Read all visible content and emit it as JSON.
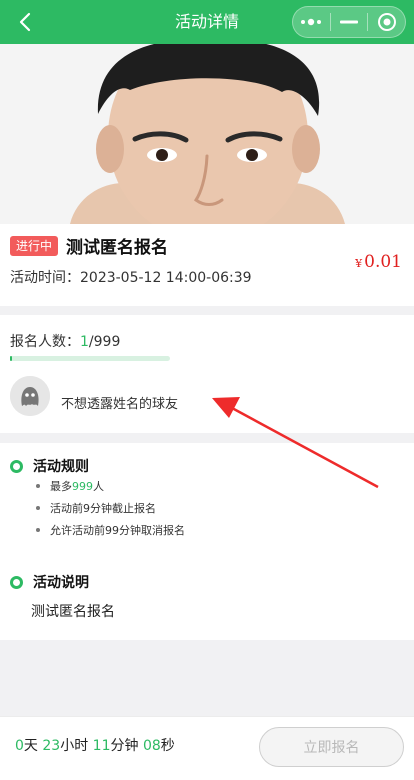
{
  "navbar": {
    "title": "活动详情",
    "icons": [
      "back-icon",
      "more-dots-icon",
      "minimize-icon",
      "close-target-icon"
    ]
  },
  "activity": {
    "status_badge": "进行中",
    "title": "测试匿名报名",
    "price_currency": "¥",
    "price_value": "0.01",
    "time_label": "活动时间：",
    "time_value": "2023-05-12 14:00-06:39"
  },
  "signup": {
    "label": "报名人数：",
    "current": "1",
    "separator": "/",
    "max": "999",
    "progress_fraction": 0.001,
    "member_name": "不想透露姓名的球友"
  },
  "rules": {
    "title": "活动规则",
    "item1_prefix": "最多",
    "item1_highlight": "999",
    "item1_suffix": "人",
    "item2": "活动前9分钟截止报名",
    "item3": "允许活动前99分钟取消报名"
  },
  "description": {
    "title": "活动说明",
    "text": "测试匿名报名"
  },
  "countdown": {
    "days": "0",
    "days_unit": "天",
    "hours": "23",
    "hours_unit": "小时",
    "minutes": "11",
    "minutes_unit": "分钟",
    "seconds": "08",
    "seconds_unit": "秒"
  },
  "action": {
    "signup_button": "立即报名"
  },
  "colors": {
    "brand": "#2dba63",
    "badge": "#f25b5b",
    "price": "#e0201f"
  }
}
